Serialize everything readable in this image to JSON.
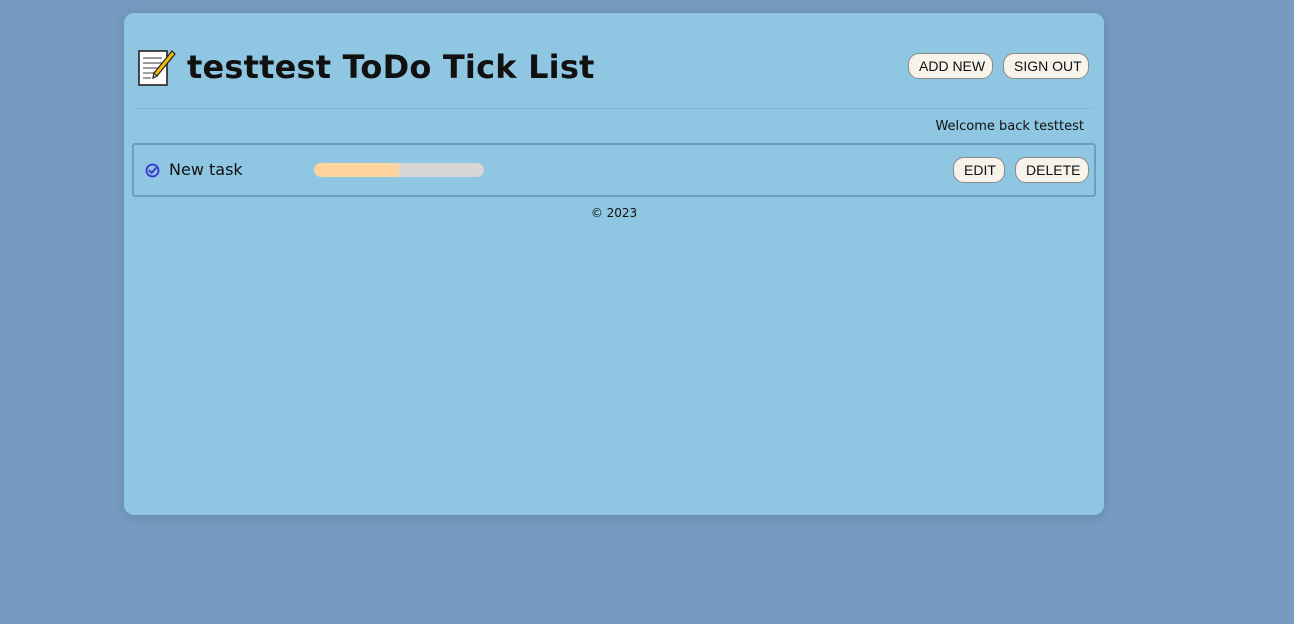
{
  "header": {
    "title": "testtest ToDo Tick List",
    "app_icon": "memo-icon",
    "add_new_label": "ADD NEW",
    "sign_out_label": "SIGN OUT"
  },
  "welcome_text": "Welcome back testtest",
  "tasks": [
    {
      "label": "New task",
      "status_icon": "check-circle-icon",
      "progress_fraction": 0.5,
      "edit_label": "EDIT",
      "delete_label": "DELETE"
    }
  ],
  "footer": {
    "text": "© 2023"
  },
  "colors": {
    "page_background": "#769bc1",
    "card_background": "#8fc7e3",
    "progress_fill": "#fdd49e",
    "progress_track": "#d6d6d6",
    "check_icon": "#3b32d6",
    "button_background": "#f6f3ea"
  }
}
